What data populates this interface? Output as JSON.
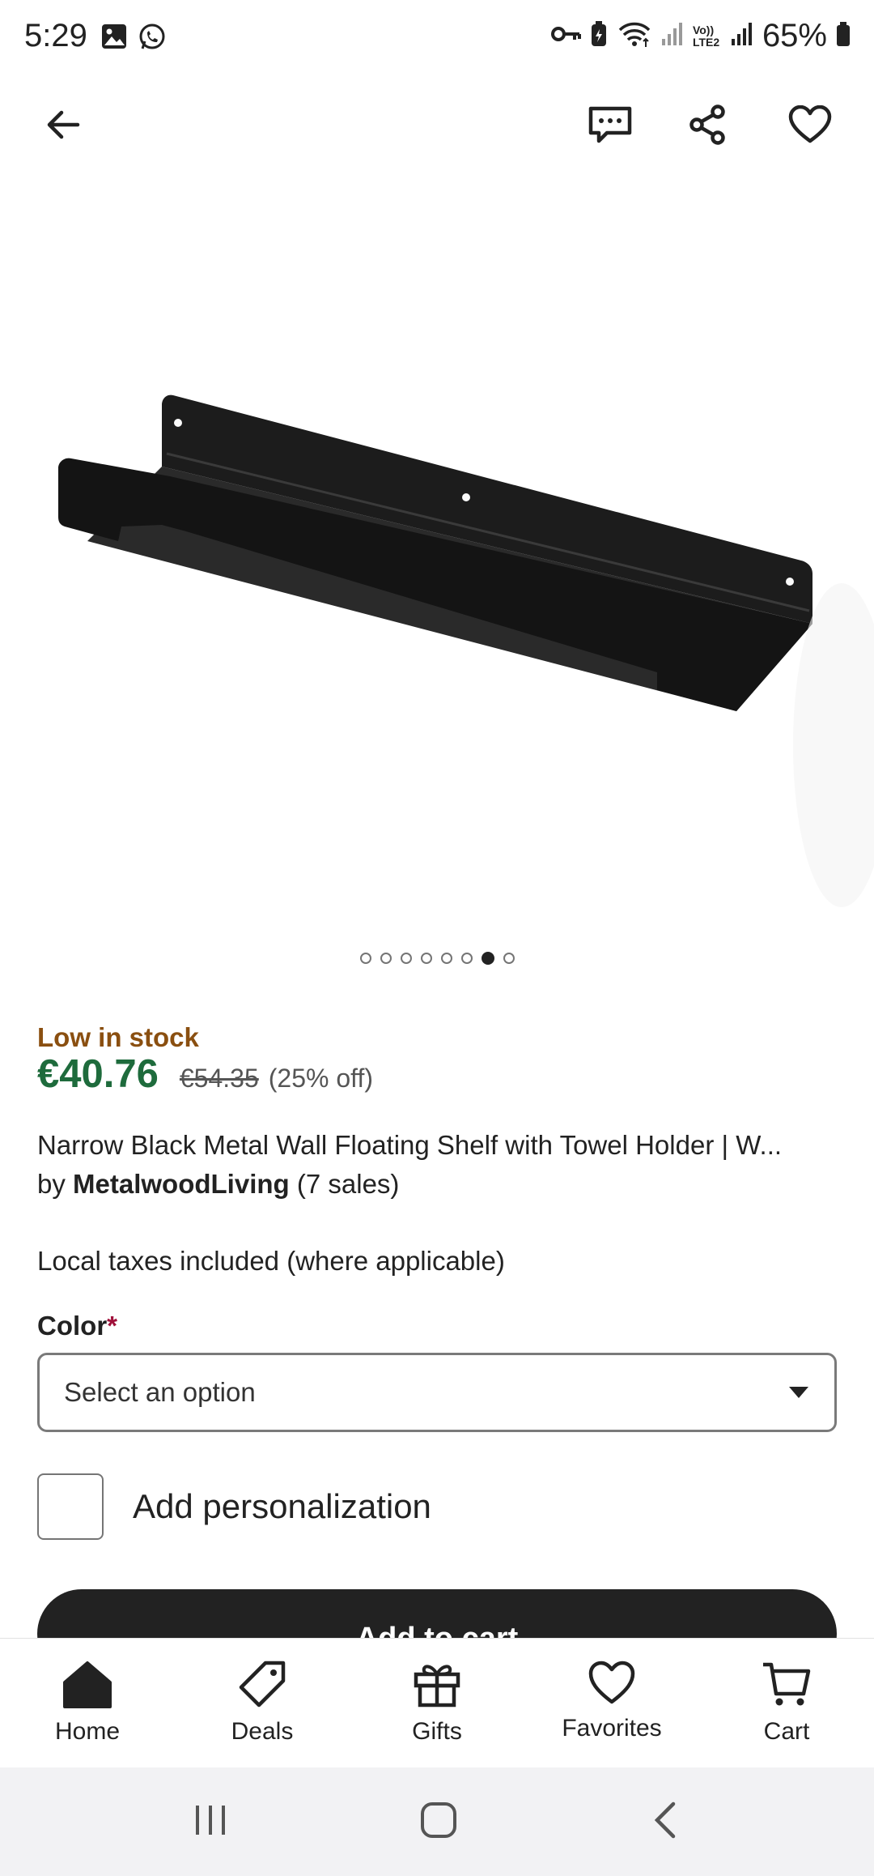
{
  "status_bar": {
    "time": "5:29",
    "left_icons": [
      "gallery-icon",
      "whatsapp-icon"
    ],
    "right_icons": [
      "key-icon",
      "battery-saver-icon",
      "wifi-icon",
      "signal-icon",
      "volte-icon",
      "signal-icon-2"
    ],
    "volte_text": "Vo)) LTE2",
    "battery": "65%"
  },
  "toolbar": {
    "icons": [
      "back-arrow-icon",
      "message-icon",
      "share-icon",
      "favorite-heart-icon"
    ]
  },
  "carousel": {
    "image_subject": "black metal wall floating shelf",
    "dot_count": 8,
    "active_index": 6
  },
  "product": {
    "stock": "Low in stock",
    "price": "€40.76",
    "old_price": "€54.35",
    "discount": "(25% off)",
    "title": "Narrow Black Metal Wall Floating Shelf with Towel Holder | W...",
    "by": "by",
    "shop": "MetalwoodLiving",
    "sales": "(7 sales)",
    "taxes": "Local taxes included (where applicable)"
  },
  "options": {
    "color_label": "Color",
    "required_mark": "*",
    "select_placeholder": "Select an option",
    "personalization_label": "Add personalization"
  },
  "cta": {
    "add_to_cart": "Add to cart"
  },
  "bottom_nav": [
    {
      "label": "Home",
      "icon": "home-icon"
    },
    {
      "label": "Deals",
      "icon": "tag-icon"
    },
    {
      "label": "Gifts",
      "icon": "gift-icon"
    },
    {
      "label": "Favorites",
      "icon": "heart-icon"
    },
    {
      "label": "Cart",
      "icon": "cart-icon"
    }
  ],
  "colors": {
    "stock": "#8a4f10",
    "price": "#1e6b3c",
    "required": "#a0103a",
    "button": "#222222"
  }
}
